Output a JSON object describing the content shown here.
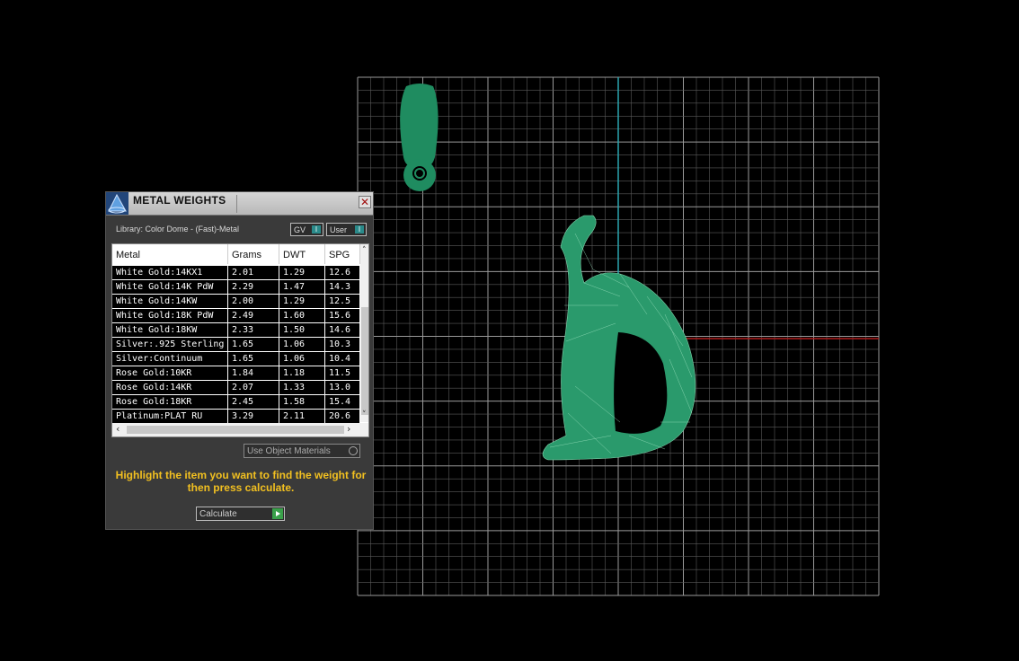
{
  "panel": {
    "title": "METAL WEIGHTS",
    "close_label": "✕",
    "library_label": "Library: Color Dome - (Fast)-Metal",
    "toggle_gv": "GV",
    "toggle_user": "User",
    "toggle_key": "I",
    "columns": [
      "Metal",
      "Grams",
      "DWT",
      "SPG"
    ],
    "rows": [
      [
        "White Gold:14KX1",
        "2.01",
        "1.29",
        "12.6"
      ],
      [
        "White Gold:14K PdW",
        "2.29",
        "1.47",
        "14.3"
      ],
      [
        "White Gold:14KW",
        "2.00",
        "1.29",
        "12.5"
      ],
      [
        "White Gold:18K PdW",
        "2.49",
        "1.60",
        "15.6"
      ],
      [
        "White Gold:18KW",
        "2.33",
        "1.50",
        "14.6"
      ],
      [
        "Silver:.925 Sterling",
        "1.65",
        "1.06",
        "10.3"
      ],
      [
        "Silver:Continuum",
        "1.65",
        "1.06",
        "10.4"
      ],
      [
        "Rose Gold:10KR",
        "1.84",
        "1.18",
        "11.5"
      ],
      [
        "Rose Gold:14KR",
        "2.07",
        "1.33",
        "13.0"
      ],
      [
        "Rose Gold:18KR",
        "2.45",
        "1.58",
        "15.4"
      ],
      [
        "Platinum:PLAT RU",
        "3.29",
        "2.11",
        "20.6"
      ]
    ],
    "materials_dropdown": "Use Object Materials",
    "hint": "Highlight the item you want to find the weight for then press calculate.",
    "calculate_label": "Calculate"
  },
  "colors": {
    "model": "#1f8c60",
    "grid": "#8a8a8a",
    "axis_x": "#b21e1e",
    "axis_y": "#2aa6b0",
    "hint": "#f2c020"
  }
}
